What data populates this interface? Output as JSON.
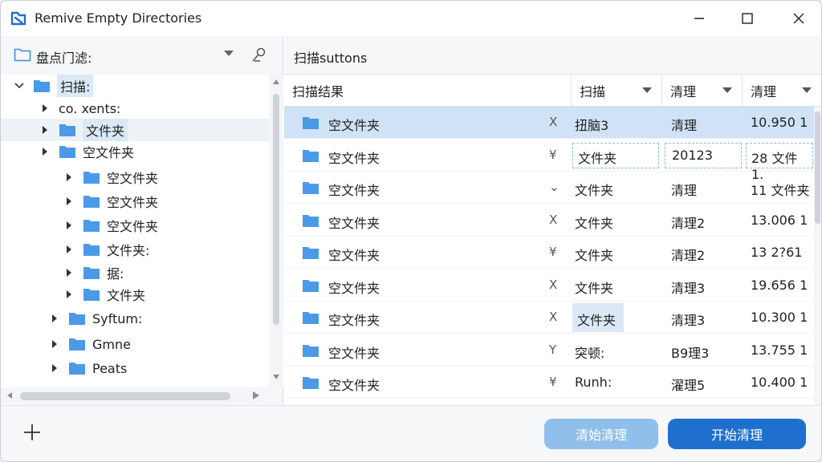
{
  "window": {
    "title": "Remive Empty Directories",
    "icon": "app-icon"
  },
  "left": {
    "header_label": "盘点门滤:",
    "tree": [
      {
        "label": "扫描:",
        "level": 0,
        "expanded": true,
        "highlight": true,
        "has_folder": true
      },
      {
        "label": "co. xents:",
        "level": 1,
        "expanded": false,
        "has_folder": false
      },
      {
        "label": "文件夹",
        "level": 1,
        "expanded": false,
        "highlight": true,
        "selected": true,
        "has_folder": true
      },
      {
        "label": "空文件夹",
        "level": 1,
        "expanded": false,
        "has_folder": true
      },
      {
        "label": "空文件夹",
        "level": 2,
        "expanded": false,
        "has_folder": true
      },
      {
        "label": "空文件夹",
        "level": 2,
        "expanded": false,
        "has_folder": true
      },
      {
        "label": "空文件夹",
        "level": 2,
        "expanded": false,
        "has_folder": true
      },
      {
        "label": "文件夹:",
        "level": 2,
        "expanded": false,
        "has_folder": true
      },
      {
        "label": "据:",
        "level": 2,
        "expanded": false,
        "has_folder": true
      },
      {
        "label": "文件夹",
        "level": 2,
        "expanded": false,
        "has_folder": true
      },
      {
        "label": "Syftum:",
        "level": 1,
        "expanded": false,
        "has_folder": true
      },
      {
        "label": "Gmne",
        "level": 1,
        "expanded": false,
        "has_folder": true
      },
      {
        "label": "Peats",
        "level": 1,
        "expanded": false,
        "has_folder": true
      }
    ]
  },
  "right": {
    "header_label": "扫描suttons",
    "columns": [
      {
        "label": "扫描结果",
        "has_arrow": false
      },
      {
        "label": "扫描",
        "has_arrow": true
      },
      {
        "label": "清理",
        "has_arrow": true
      },
      {
        "label": "清理",
        "has_arrow": true
      }
    ],
    "rows": [
      {
        "name": "空文件夹",
        "mark": "X",
        "c1": "扭脑3",
        "c2": "清理",
        "c3": "10.950 1",
        "selected": true
      },
      {
        "name": "空文件夹",
        "mark": "¥",
        "c1": "文件夹",
        "c2": "20123",
        "c3": "28 文件1.",
        "boxed": true
      },
      {
        "name": "空文件夹",
        "mark": "⌄",
        "c1": "文件夹",
        "c2": "清理",
        "c3": "11 文件夹"
      },
      {
        "name": "空文件夹",
        "mark": "X",
        "c1": "文件夹",
        "c2": "清理2",
        "c3": "13.006 1"
      },
      {
        "name": "空文件夹",
        "mark": "¥",
        "c1": "文件夹",
        "c2": "清理2",
        "c3": "13 2?61"
      },
      {
        "name": "空文件夹",
        "mark": "X",
        "c1": "文件夹",
        "c2": "清理3",
        "c3": "19.656 1"
      },
      {
        "name": "空文件夹",
        "mark": "X",
        "c1": "文件夹",
        "c2": "清理3",
        "c3": "10.300 1",
        "c1_highlight": true
      },
      {
        "name": "空文件夹",
        "mark": "Y",
        "c1": "突顿:",
        "c2": "B9理3",
        "c3": "13.755 1"
      },
      {
        "name": "空文件夹",
        "mark": "¥",
        "c1": "Runh:",
        "c2": "濯理5",
        "c3": "10.400 1"
      }
    ]
  },
  "footer": {
    "clear_label": "清始清理",
    "start_label": "开始清理"
  },
  "colors": {
    "accent": "#1f6fcf",
    "accent_light": "#8fbfea",
    "folder": "#4a9ae6",
    "selection": "#cfe2f6"
  }
}
